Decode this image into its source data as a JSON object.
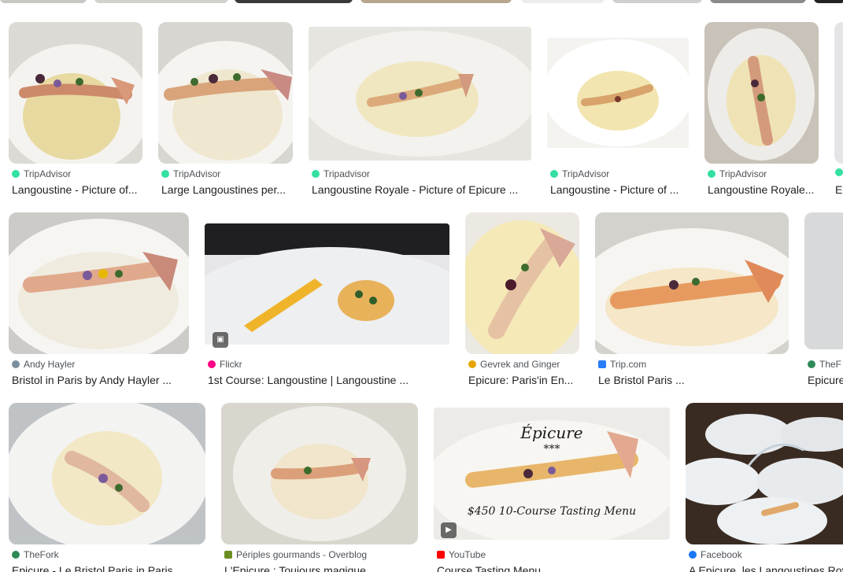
{
  "results": [
    {
      "source": "TripAdvisor",
      "title": "Langoustine - Picture of...",
      "icon": "tripadvisor-icon",
      "icon_color": "#34e0a1"
    },
    {
      "source": "TripAdvisor",
      "title": "Large Langoustines per...",
      "icon": "tripadvisor-icon",
      "icon_color": "#34e0a1"
    },
    {
      "source": "Tripadvisor",
      "title": "Langoustine Royale - Picture of Epicure ...",
      "icon": "tripadvisor-icon",
      "icon_color": "#34e0a1"
    },
    {
      "source": "TripAdvisor",
      "title": "Langoustine - Picture of ...",
      "icon": "tripadvisor-icon",
      "icon_color": "#34e0a1"
    },
    {
      "source": "TripAdvisor",
      "title": "Langoustine Royale...",
      "icon": "tripadvisor-icon",
      "icon_color": "#34e0a1"
    },
    {
      "source": "",
      "title": "E",
      "icon": "tripadvisor-icon",
      "icon_color": "#34e0a1"
    },
    {
      "source": "Andy Hayler",
      "title": "Bristol in Paris by Andy Hayler ...",
      "icon": "andy-hayler-icon",
      "icon_color": "#7a8f9e"
    },
    {
      "source": "Flickr",
      "title": "1st Course: Langoustine | Langoustine ...",
      "icon": "flickr-icon",
      "icon_color": "#ff0084"
    },
    {
      "source": "Gevrek and Ginger",
      "title": "Epicure: Paris'in En...",
      "icon": "gevrek-ginger-icon",
      "icon_color": "#e6a500"
    },
    {
      "source": "Trip.com",
      "title": "Le Bristol Paris ...",
      "icon": "tripcom-icon",
      "icon_color": "#287dfa"
    },
    {
      "source": "TheF",
      "title": "Epicure",
      "icon": "thefork-icon",
      "icon_color": "#2e8b57"
    },
    {
      "source": "TheFork",
      "title": "Epicure - Le Bristol Paris in Paris ...",
      "icon": "thefork-icon",
      "icon_color": "#2e8b57"
    },
    {
      "source": "Périples gourmands - Overblog",
      "title": "L'Epicure : Toujours magique ...",
      "icon": "overblog-icon",
      "icon_color": "#6b8e23"
    },
    {
      "source": "YouTube",
      "title": "Course Tasting Menu ...",
      "icon": "youtube-icon",
      "icon_color": "#ff0000"
    },
    {
      "source": "Facebook",
      "title": "A Epicure, les Langoustines Royales ...",
      "icon": "facebook-icon",
      "icon_color": "#1877f2"
    }
  ],
  "overlay_text": {
    "epicure_title": "Épicure",
    "stars": "***",
    "menu_price": "$450 10-Course Tasting Menu"
  }
}
